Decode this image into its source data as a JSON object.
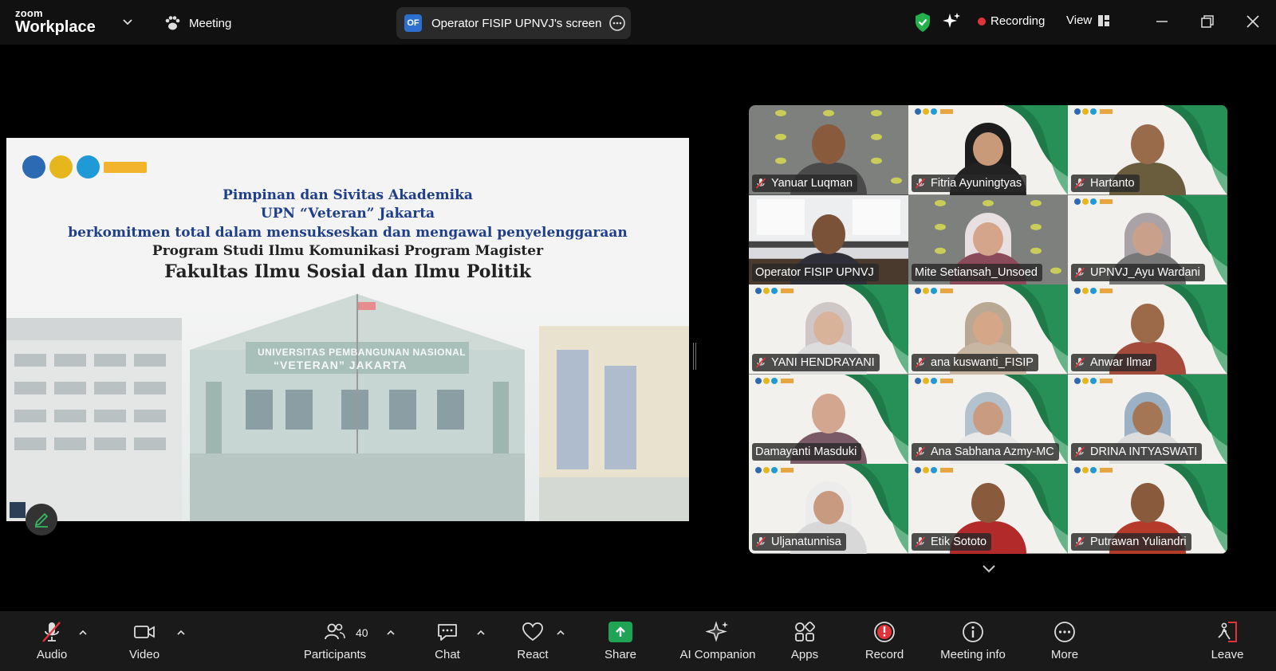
{
  "app": {
    "brand_top": "zoom",
    "brand_bottom": "Workplace",
    "meeting_label": "Meeting",
    "share_badge": "OF",
    "share_title": "Operator FISIP UPNVJ's screen",
    "recording_label": "Recording",
    "view_label": "View"
  },
  "colors": {
    "accent_green": "#35c465",
    "record_red": "#e0343b",
    "share_green": "#1fa354",
    "toolbar_bg": "#1a1a1a"
  },
  "slide": {
    "line1": "Pimpinan dan Sivitas Akademika",
    "line2": "UPN “Veteran” Jakarta",
    "line3": "berkomitmen total dalam mensukseskan dan mengawal penyelenggaraan",
    "line4": "Program Studi Ilmu Komunikasi Program Magister",
    "line5": "Fakultas Ilmu Sosial dan Ilmu Politik",
    "building_line1": "UNIVERSITAS PEMBANGUNAN NASIONAL",
    "building_line2": "“VETERAN” JAKARTA"
  },
  "participants": [
    {
      "name": "Yanuar Luqman",
      "muted": true,
      "active": false
    },
    {
      "name": "Fitria Ayuningtyas",
      "muted": true,
      "active": false
    },
    {
      "name": "Hartanto",
      "muted": true,
      "active": false
    },
    {
      "name": "Operator FISIP UPNVJ",
      "muted": false,
      "active": true
    },
    {
      "name": "Mite Setiansah_Unsoed",
      "muted": false,
      "active": false
    },
    {
      "name": "UPNVJ_Ayu Wardani",
      "muted": true,
      "active": false
    },
    {
      "name": "YANI HENDRAYANI",
      "muted": true,
      "active": false
    },
    {
      "name": "ana kuswanti_FISIP",
      "muted": true,
      "active": false
    },
    {
      "name": "Anwar Ilmar",
      "muted": true,
      "active": false
    },
    {
      "name": "Damayanti Masduki",
      "muted": false,
      "active": false
    },
    {
      "name": "Ana Sabhana Azmy-MC",
      "muted": true,
      "active": false
    },
    {
      "name": "DRINA INTYASWATI",
      "muted": true,
      "active": false
    },
    {
      "name": "Uljanatunnisa",
      "muted": true,
      "active": false
    },
    {
      "name": "Etik Sototo",
      "muted": true,
      "active": false
    },
    {
      "name": "Putrawan Yuliandri",
      "muted": true,
      "active": false
    }
  ],
  "toolbar": {
    "audio": "Audio",
    "video": "Video",
    "participants": "Participants",
    "participants_count": "40",
    "chat": "Chat",
    "react": "React",
    "share": "Share",
    "ai_companion": "AI Companion",
    "apps": "Apps",
    "record": "Record",
    "meeting_info": "Meeting info",
    "more": "More",
    "leave": "Leave"
  }
}
